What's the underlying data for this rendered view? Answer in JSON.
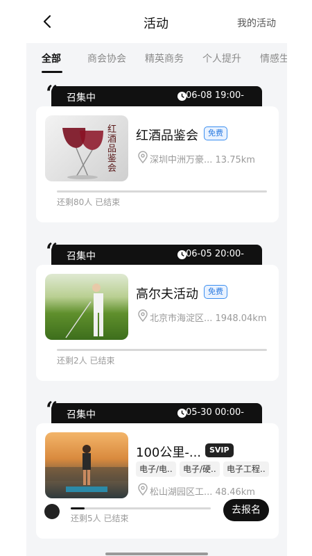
{
  "header": {
    "title": "活动",
    "my_activities": "我的活动"
  },
  "tabs": [
    "全部",
    "商会协会",
    "精英商务",
    "个人提升",
    "情感生"
  ],
  "events": [
    {
      "status": "召集中",
      "time": "06-08 19:00-",
      "name": "红酒品鉴会",
      "badge": "免费",
      "location": "深圳中洲万豪... 13.75km",
      "remaining": "还剩80人 已结束",
      "thumb_text": "红酒品鉴会"
    },
    {
      "status": "召集中",
      "time": "06-05 20:00-",
      "name": "高尔夫活动",
      "badge": "免费",
      "location": "北京市海淀区... 1948.04km",
      "remaining": "还剩2人 已结束"
    },
    {
      "status": "召集中",
      "time": "05-30 00:00-",
      "name": "100公里-...",
      "badge": "SVIP",
      "tags": [
        "电子/电..",
        "电子/硬..",
        "电子工程.."
      ],
      "location": "松山湖园区工... 48.46km",
      "remaining": "还剩5人 已结束",
      "button": "去报名",
      "progress": 0.1
    }
  ]
}
